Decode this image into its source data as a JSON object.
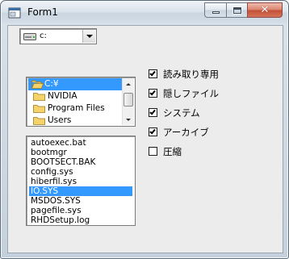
{
  "window": {
    "title": "Form1",
    "close_glyph": "✕"
  },
  "drive": {
    "value": "c:",
    "icon": "drive-icon"
  },
  "directories": [
    {
      "label": "C:¥",
      "selected": true,
      "icon": "folder-open-icon"
    },
    {
      "label": "NVIDIA",
      "selected": false,
      "icon": "folder-icon"
    },
    {
      "label": "Program Files",
      "selected": false,
      "icon": "folder-icon"
    },
    {
      "label": "Users",
      "selected": false,
      "icon": "folder-icon"
    }
  ],
  "files": [
    {
      "name": "autoexec.bat",
      "selected": false
    },
    {
      "name": "bootmgr",
      "selected": false
    },
    {
      "name": "BOOTSECT.BAK",
      "selected": false
    },
    {
      "name": "config.sys",
      "selected": false
    },
    {
      "name": "hiberfil.sys",
      "selected": false
    },
    {
      "name": "IO.SYS",
      "selected": true
    },
    {
      "name": "MSDOS.SYS",
      "selected": false
    },
    {
      "name": "pagefile.sys",
      "selected": false
    },
    {
      "name": "RHDSetup.log",
      "selected": false
    }
  ],
  "checkboxes": [
    {
      "label": "読み取り専用",
      "checked": true
    },
    {
      "label": "隠しファイル",
      "checked": true
    },
    {
      "label": "システム",
      "checked": true
    },
    {
      "label": "アーカイブ",
      "checked": true
    },
    {
      "label": "圧縮",
      "checked": false
    }
  ],
  "colors": {
    "selection": "#3399ff",
    "close_button": "#c24e33"
  }
}
